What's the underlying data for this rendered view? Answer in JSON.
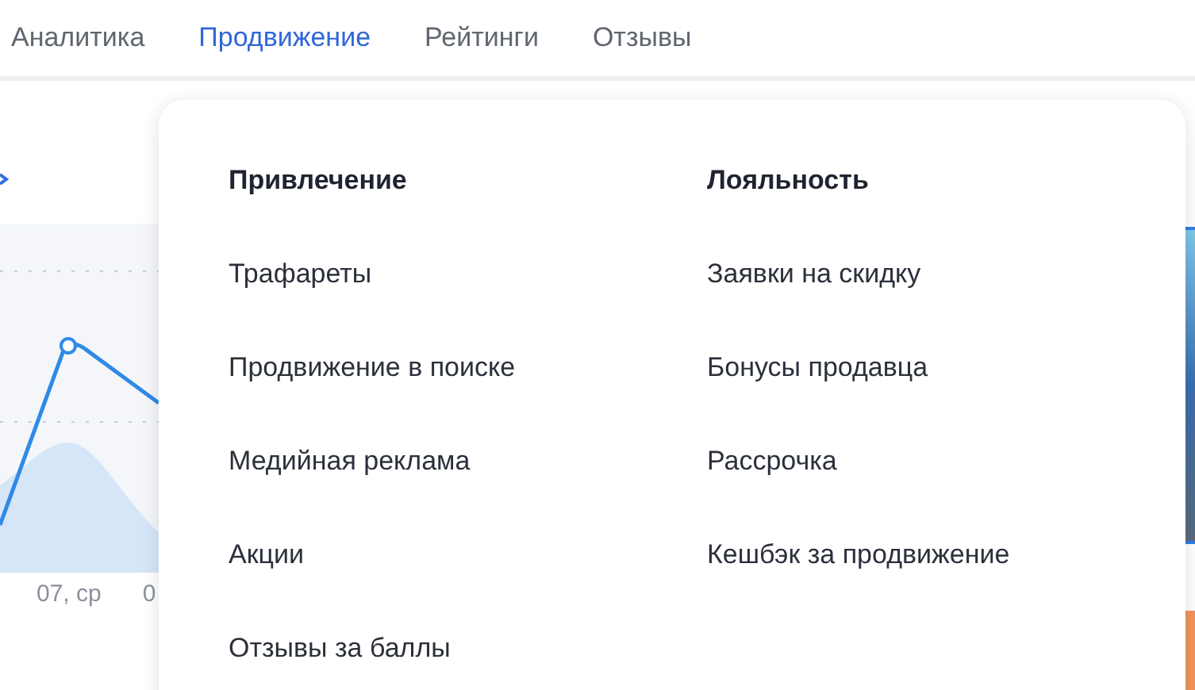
{
  "tabs": [
    {
      "label": "Аналитика",
      "selected": false
    },
    {
      "label": "Продвижение",
      "selected": true
    },
    {
      "label": "Рейтинги",
      "selected": false
    },
    {
      "label": "Отзывы",
      "selected": false
    }
  ],
  "background": {
    "x_labels": [
      "07, ср",
      "0"
    ]
  },
  "menu": {
    "columns": [
      {
        "heading": "Привлечение",
        "items": [
          "Трафареты",
          "Продвижение в поиске",
          "Медийная реклама",
          "Акции",
          "Отзывы за баллы"
        ]
      },
      {
        "heading": "Лояльность",
        "items": [
          "Заявки на скидку",
          "Бонусы продавца",
          "Рассрочка",
          "Кешбэк за продвижение"
        ]
      }
    ]
  }
}
